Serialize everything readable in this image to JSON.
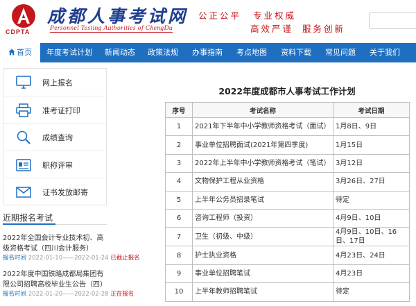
{
  "header": {
    "logo_text": "CDPTA",
    "site_name_cn": "成都人事考试网",
    "site_name_en": "Personnel Testing Authorities of ChengDu",
    "slogans": [
      "公正公平",
      "专业权威",
      "高效严谨",
      "服务创新"
    ]
  },
  "nav": {
    "items": [
      {
        "label": "首页",
        "active": true,
        "icon": "home-icon"
      },
      {
        "label": "年度考试计划",
        "active": false
      },
      {
        "label": "新闻动态",
        "active": false
      },
      {
        "label": "政策法规",
        "active": false
      },
      {
        "label": "办事指南",
        "active": false
      },
      {
        "label": "考点地图",
        "active": false
      },
      {
        "label": "资料下载",
        "active": false
      },
      {
        "label": "常见问题",
        "active": false
      },
      {
        "label": "关于我们",
        "active": false
      }
    ]
  },
  "quick_links": [
    {
      "label": "网上报名",
      "icon": "monitor-icon"
    },
    {
      "label": "准考证打印",
      "icon": "printer-icon"
    },
    {
      "label": "成绩查询",
      "icon": "magnifier-icon"
    },
    {
      "label": "职称评审",
      "icon": "id-card-icon"
    },
    {
      "label": "证书发放邮寄",
      "icon": "envelope-icon"
    }
  ],
  "recent": {
    "title": "近期报名考试",
    "items": [
      {
        "title": "2022年全国会计专业技术初、高级资格考试（四川会计服务）",
        "meta_label": "报名时间",
        "dates": "2022-01-10——2022-01-24",
        "status": "已截止报名"
      },
      {
        "title": "2022年度中国铁路成都局集团有限公司招聘高校毕业生公告（四）",
        "meta_label": "报名时间",
        "dates": "2022-01-20——2022-02-28",
        "status": "正在报名"
      }
    ]
  },
  "main": {
    "title": "2022年度成都市人事考试工作计划",
    "columns": [
      "序号",
      "考试名称",
      "考试日期"
    ],
    "rows": [
      {
        "no": "1",
        "name": "2021年下半年中小学教师资格考试（面试）",
        "date": "1月8日、9日"
      },
      {
        "no": "2",
        "name": "事业单位招聘面试(2021年第四季度)",
        "date": "1月15日"
      },
      {
        "no": "3",
        "name": "2022年上半年中小学教师资格考试（笔试）",
        "date": "3月12日"
      },
      {
        "no": "4",
        "name": "文物保护工程从业资格",
        "date": "3月26日、27日"
      },
      {
        "no": "5",
        "name": "上半年公务员招录笔试",
        "date": "待定"
      },
      {
        "no": "6",
        "name": "咨询工程师（投资）",
        "date": "4月9日、10日"
      },
      {
        "no": "7",
        "name": "卫生（初级、中级）",
        "date": "4月9日、10日、16日、17日"
      },
      {
        "no": "8",
        "name": "护士执业资格",
        "date": "4月23日、24日"
      },
      {
        "no": "9",
        "name": "事业单位招聘笔试",
        "date": "4月23日"
      },
      {
        "no": "10",
        "name": "上半年教师招聘笔试",
        "date": "待定"
      }
    ]
  },
  "colors": {
    "brand_blue": "#1f6fc1",
    "brand_red": "#c4161c"
  }
}
